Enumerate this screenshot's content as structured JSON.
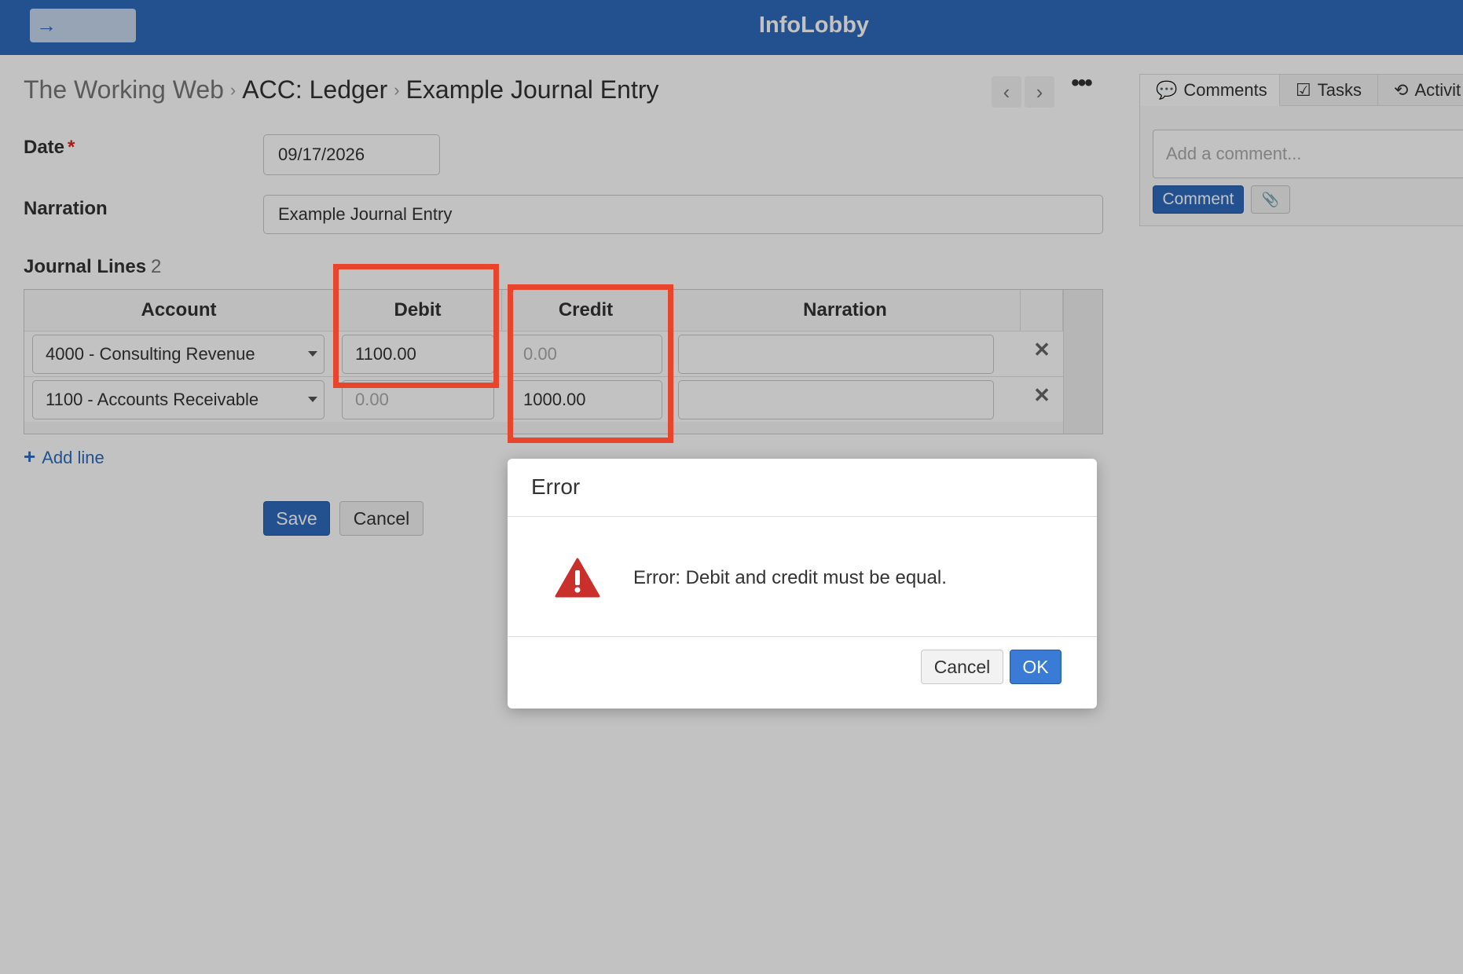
{
  "app": {
    "title": "InfoLobby",
    "back_icon": "→"
  },
  "breadcrumb": {
    "workspace": "The Working Web",
    "app": "ACC: Ledger",
    "item": "Example Journal Entry",
    "separator": "›"
  },
  "nav": {
    "prev": "‹",
    "next": "›",
    "more": "•••"
  },
  "form": {
    "date_label": "Date",
    "required_mark": "*",
    "date_value": "09/17/2026",
    "narration_label": "Narration",
    "narration_value": "Example Journal Entry"
  },
  "journal_lines": {
    "title": "Journal Lines",
    "count": "2",
    "columns": [
      "Account",
      "Debit",
      "Credit",
      "Narration"
    ],
    "rows": [
      {
        "account": "4000 - Consulting Revenue",
        "debit": "1100.00",
        "credit": "0.00",
        "narration": ""
      },
      {
        "account": "1100 - Accounts Receivable",
        "debit": "0.00",
        "credit": "1000.00",
        "narration": ""
      }
    ],
    "delete_icon": "✕",
    "add_line": "Add line",
    "add_icon": "+"
  },
  "actions": {
    "save": "Save",
    "cancel": "Cancel"
  },
  "side_panel": {
    "tabs": [
      {
        "label": "Comments",
        "icon": "💬"
      },
      {
        "label": "Tasks",
        "icon": "☑"
      },
      {
        "label": "Activit",
        "icon": "⟲"
      }
    ],
    "comment_placeholder": "Add a comment...",
    "comment_button": "Comment",
    "attach_icon": "📎"
  },
  "dialog": {
    "title": "Error",
    "message": "Error: Debit and credit must be equal.",
    "cancel": "Cancel",
    "ok": "OK"
  },
  "colors": {
    "brand": "#2f6bbd",
    "highlight": "#e8452c",
    "warning": "#c9302c"
  }
}
